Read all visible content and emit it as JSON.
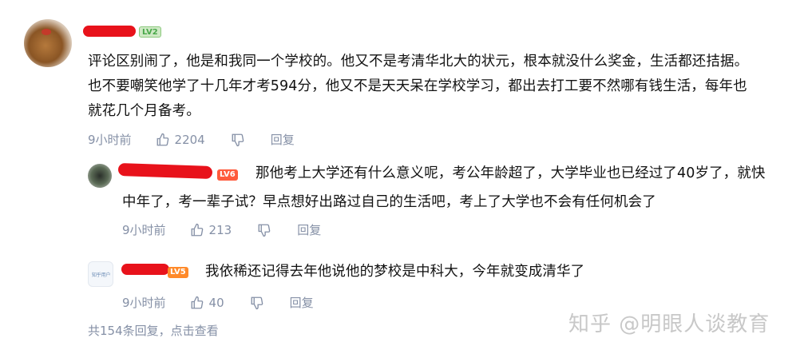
{
  "main_comment": {
    "user_level": "LV2",
    "text_lines": [
      "评论区别闹了，他是和我同一个学校的。他又不是考清华北大的状元，根本就没什么奖金，生活都还拮据。",
      "也不要嘲笑他学了十几年才考594分，他又不是天天呆在学校学习，都出去打工要不然哪有钱生活，每年也",
      "就花几个月备考。"
    ],
    "time": "9小时前",
    "likes": "2204",
    "reply_label": "回复"
  },
  "replies": [
    {
      "user_level": "LV6",
      "text_lines": [
        "那他考上大学还有什么意义呢，考公年龄超了，大学毕业也已经过了40岁了，就快",
        "中年了，考一辈子试？早点想好出路过自己的生活吧，考上了大学也不会有任何机会了"
      ],
      "time": "9小时前",
      "likes": "213",
      "reply_label": "回复"
    },
    {
      "user_level": "LV5",
      "avatar_text": "知乎用户",
      "text_lines": [
        "我依稀还记得去年他说他的梦校是中科大，今年就变成清华了"
      ],
      "time": "9小时前",
      "likes": "40",
      "reply_label": "回复"
    }
  ],
  "more_replies": "共154条回复，点击查看",
  "watermark": "知乎 @明眼人谈教育",
  "colors": {
    "meta_gray": "#8590a6",
    "redaction": "#e8121b"
  }
}
